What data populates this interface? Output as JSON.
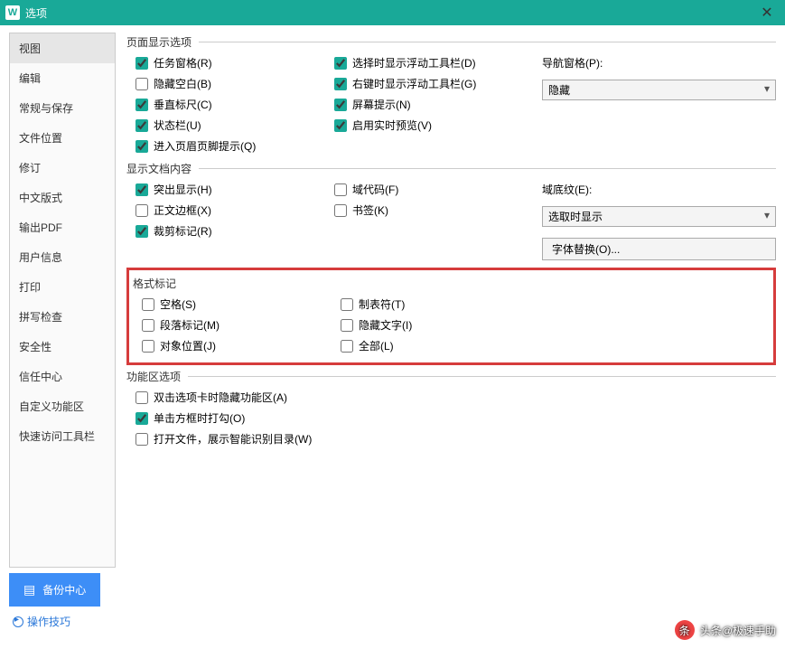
{
  "titlebar": {
    "title": "选项"
  },
  "sidebar": {
    "items": [
      "视图",
      "编辑",
      "常规与保存",
      "文件位置",
      "修订",
      "中文版式",
      "输出PDF",
      "用户信息",
      "打印",
      "拼写检查",
      "安全性",
      "信任中心",
      "自定义功能区",
      "快速访问工具栏"
    ],
    "active_index": 0
  },
  "sections": {
    "page_display": {
      "legend": "页面显示选项",
      "col1": [
        {
          "label": "任务窗格(R)",
          "checked": true
        },
        {
          "label": "隐藏空白(B)",
          "checked": false
        },
        {
          "label": "垂直标尺(C)",
          "checked": true
        },
        {
          "label": "状态栏(U)",
          "checked": true
        },
        {
          "label": "进入页眉页脚提示(Q)",
          "checked": true
        }
      ],
      "col2": [
        {
          "label": "选择时显示浮动工具栏(D)",
          "checked": true
        },
        {
          "label": "右键时显示浮动工具栏(G)",
          "checked": true
        },
        {
          "label": "屏幕提示(N)",
          "checked": true
        },
        {
          "label": "启用实时预览(V)",
          "checked": true
        }
      ],
      "nav": {
        "label": "导航窗格(P):",
        "value": "隐藏"
      }
    },
    "doc_content": {
      "legend": "显示文档内容",
      "col1": [
        {
          "label": "突出显示(H)",
          "checked": true
        },
        {
          "label": "正文边框(X)",
          "checked": false
        },
        {
          "label": "裁剪标记(R)",
          "checked": true
        }
      ],
      "col2": [
        {
          "label": "域代码(F)",
          "checked": false
        },
        {
          "label": "书签(K)",
          "checked": false
        }
      ],
      "shading": {
        "label": "域底纹(E):",
        "value": "选取时显示"
      },
      "font_substitute": "字体替换(O)..."
    },
    "format_marks": {
      "legend": "格式标记",
      "col1": [
        {
          "label": "空格(S)",
          "checked": false
        },
        {
          "label": "段落标记(M)",
          "checked": false
        },
        {
          "label": "对象位置(J)",
          "checked": false
        }
      ],
      "col2": [
        {
          "label": "制表符(T)",
          "checked": false
        },
        {
          "label": "隐藏文字(I)",
          "checked": false
        },
        {
          "label": "全部(L)",
          "checked": false
        }
      ]
    },
    "ribbon": {
      "legend": "功能区选项",
      "items": [
        {
          "label": "双击选项卡时隐藏功能区(A)",
          "checked": false
        },
        {
          "label": "单击方框时打勾(O)",
          "checked": true
        },
        {
          "label": "打开文件，展示智能识别目录(W)",
          "checked": false
        }
      ]
    }
  },
  "footer": {
    "backup": "备份中心",
    "tips": "操作技巧"
  },
  "watermark": "头条@极速手助"
}
